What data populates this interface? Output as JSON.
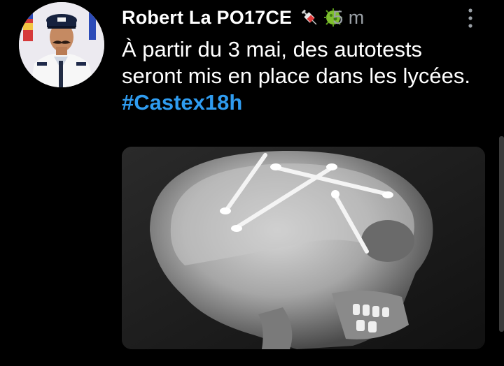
{
  "tweet": {
    "author_name": "Robert La PO17CE",
    "author_emojis": [
      "syringe-emoji",
      "microbe-emoji"
    ],
    "timestamp": "5 m",
    "text_before_hashtag": "À partir du 3 mai, des autotests seront mis en place dans les lycées. ",
    "hashtag": "#Castex18h",
    "media_icon": "skull-xray-with-cotton-swabs"
  },
  "colors": {
    "background": "#000000",
    "text": "#ffffff",
    "muted": "#9aa0a6",
    "hashtag": "#2f9cf0"
  }
}
